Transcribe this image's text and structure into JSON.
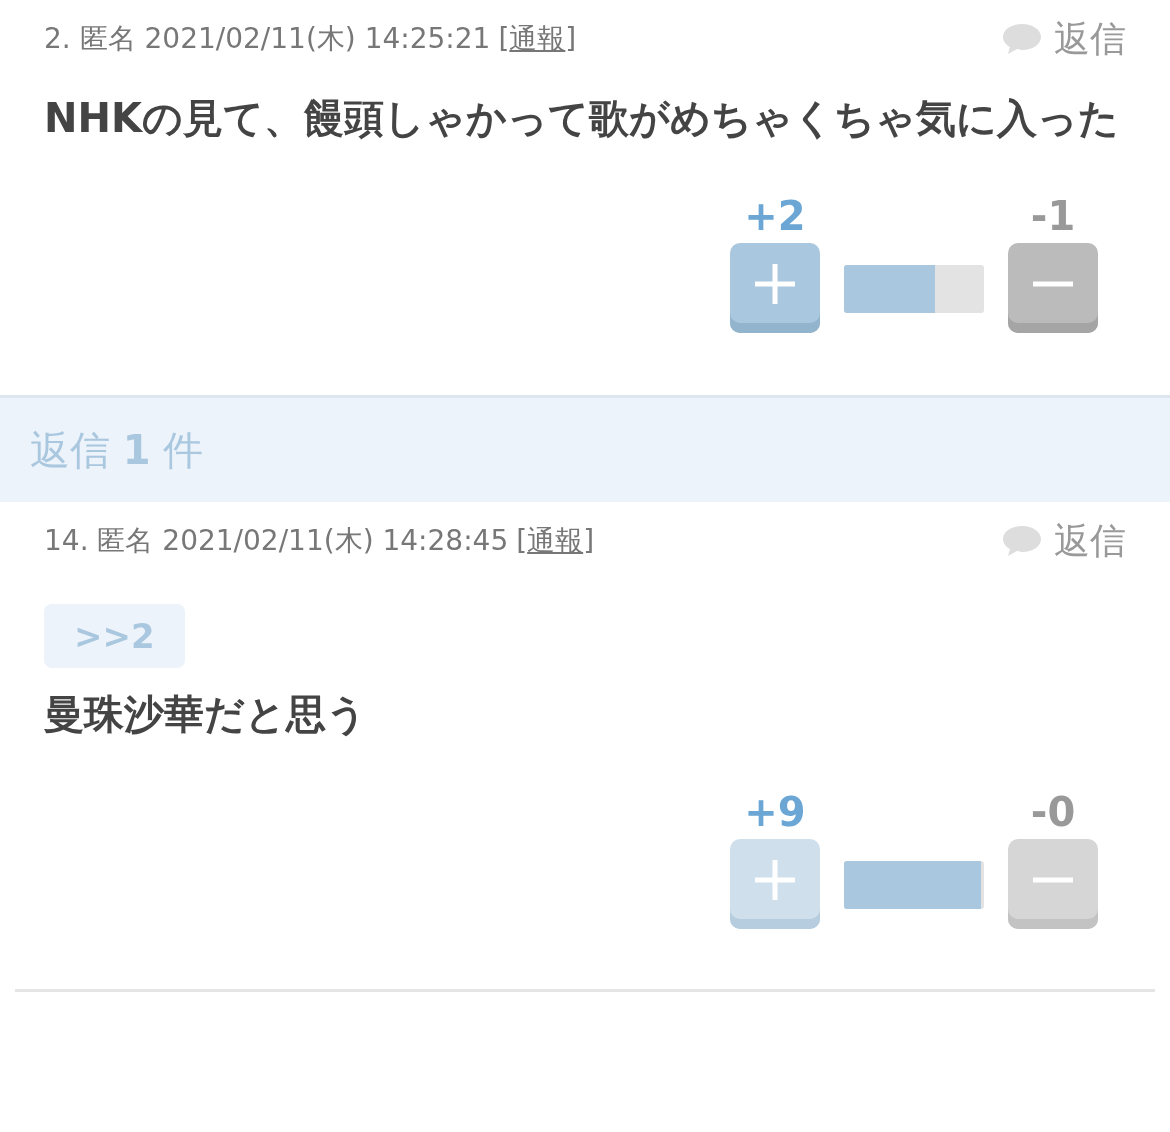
{
  "comments": [
    {
      "meta": "2. 匿名 2021/02/11(木) 14:25:21",
      "report": {
        "open": "[",
        "label": "通報",
        "close": "]"
      },
      "reply_label": "返信",
      "body": "NHKの見て、饅頭しゃかって歌がめちゃくちゃ気に入った",
      "votes": {
        "plus": "+2",
        "minus": "-1",
        "level": 0.65,
        "voted": true
      }
    },
    {
      "meta": "14. 匿名 2021/02/11(木) 14:28:45",
      "report": {
        "open": "[",
        "label": "通報",
        "close": "]"
      },
      "reply_label": "返信",
      "quote": ">>2",
      "body": "曼珠沙華だと思う",
      "votes": {
        "plus": "+9",
        "minus": "-0",
        "level": 0.98,
        "voted": false
      }
    }
  ],
  "replies_bar": "返信 **1** 件"
}
